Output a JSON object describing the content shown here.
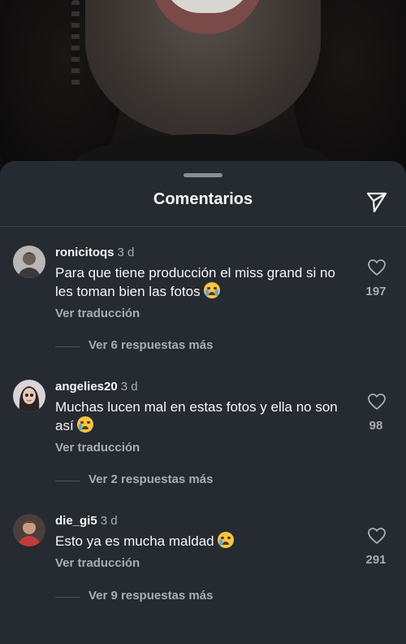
{
  "sheet": {
    "title": "Comentarios",
    "share_icon": "send-icon"
  },
  "comments": [
    {
      "username": "ronicitoqs",
      "time": "3 d",
      "text": "Para que tiene producción el miss grand si no les toman bien las fotos",
      "emoji": "loudly-crying-face",
      "translate_label": "Ver traducción",
      "replies_label": "Ver 6 respuestas más",
      "likes": "197"
    },
    {
      "username": "angelies20",
      "time": "3 d",
      "text": "Muchas lucen mal en estas fotos y ella no son así",
      "emoji": "crying-face",
      "translate_label": "Ver traducción",
      "replies_label": "Ver 2 respuestas más",
      "likes": "98"
    },
    {
      "username": "die_gi5",
      "time": "3 d",
      "text": "Esto ya es mucha maldad",
      "emoji": "crying-face",
      "translate_label": "Ver traducción",
      "replies_label": "Ver 9 respuestas más",
      "likes": "291"
    }
  ],
  "colors": {
    "sheet_background": "#262a31",
    "primary_text": "#f5f5f5",
    "secondary_text": "#a8acb3"
  }
}
